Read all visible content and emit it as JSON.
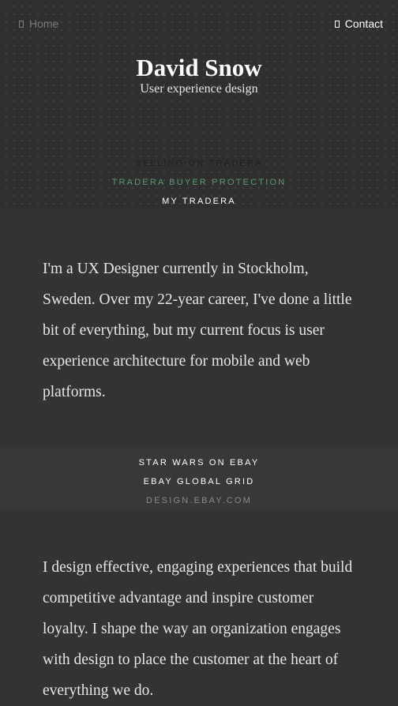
{
  "nav": {
    "home_label": "Home",
    "contact_label": "Contact"
  },
  "header": {
    "title": "David Snow",
    "subtitle": "User experience design"
  },
  "header_links": [
    {
      "label": "SELLING ON TRADERA"
    },
    {
      "label": "TRADERA BUYER PROTECTION"
    },
    {
      "label": "MY TRADERA"
    }
  ],
  "intro_paragraph": "I'm a UX Designer currently in Stockholm, Sweden. Over my 22-year career, I've done a little bit of everything, but my current focus is user experience architecture for mobile and web platforms.",
  "band_links": [
    {
      "label": "STAR WARS ON EBAY"
    },
    {
      "label": "EBAY GLOBAL GRID"
    },
    {
      "label": "DESIGN.EBAY.COM"
    }
  ],
  "second_paragraph": "I design effective, engaging experiences that build competitive advantage and inspire customer loyalty. I shape the way an organization engages with design to place the customer at the heart of everything we do.",
  "colors": {
    "background": "#333333",
    "header_background": "#2f2f2f",
    "accent_green": "#5b9a6e"
  }
}
